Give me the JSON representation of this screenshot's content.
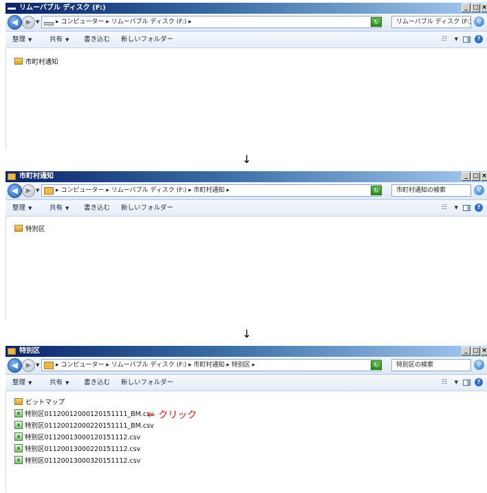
{
  "windows": [
    {
      "title": "リムーバブル ディスク (F:)",
      "title_icon": "drive-icon",
      "address_path": "▸ コンピューター ▸ リムーバブル ディスク (F:) ▸",
      "address_icon": "drive-icon",
      "search_placeholder": "リムーバブル ディスク (F:)…",
      "items": [
        {
          "label": "市町村通知",
          "type": "folder"
        }
      ]
    },
    {
      "title": "市町村通知",
      "title_icon": "folder-icon",
      "address_path": "▸ コンピューター ▸ リムーバブル ディスク (F:) ▸ 市町村通知 ▸",
      "address_icon": "folder-icon",
      "search_placeholder": "市町村通知の検索",
      "items": [
        {
          "label": "特別区",
          "type": "folder"
        }
      ]
    },
    {
      "title": "特別区",
      "title_icon": "folder-icon",
      "address_path": "▸ コンピューター ▸ リムーバブル ディスク (F:) ▸ 市町村通知 ▸ 特別区 ▸",
      "address_icon": "folder-icon",
      "search_placeholder": "特別区の検索",
      "items": [
        {
          "label": "ビットマップ",
          "type": "folder"
        },
        {
          "label": "特別区01120012000120151111_BM.csv",
          "type": "csv"
        },
        {
          "label": "特別区01120012000220151111_BM.csv",
          "type": "csv"
        },
        {
          "label": "特別区01120013000120151112.csv",
          "type": "csv"
        },
        {
          "label": "特別区01120013000220151112.csv",
          "type": "csv"
        },
        {
          "label": "特別区01120013000320151112.csv",
          "type": "csv"
        }
      ]
    }
  ],
  "toolbar": {
    "organize": "整理",
    "share": "共有",
    "burn": "書き込む",
    "new_folder": "新しいフォルダー"
  },
  "window_buttons": {
    "minimize": "_",
    "maximize": "□",
    "close": "×"
  },
  "flow_arrow": "↓",
  "annotation": {
    "text": "← クリック",
    "color": "#e8141a"
  }
}
